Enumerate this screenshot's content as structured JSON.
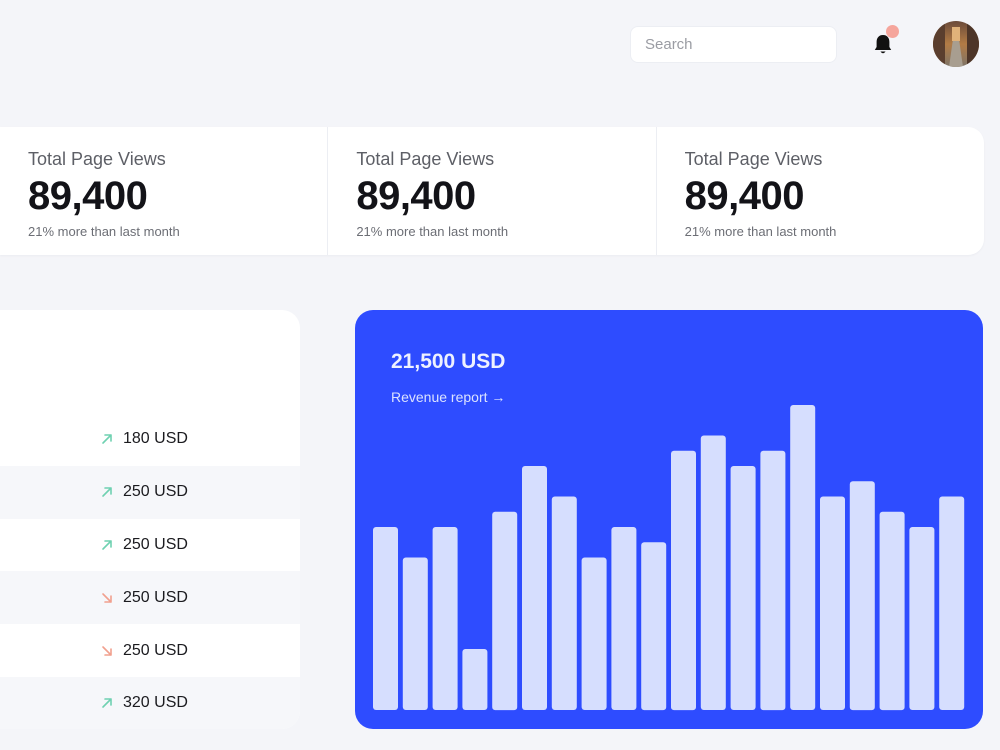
{
  "header": {
    "search_placeholder": "Search",
    "has_notification": true
  },
  "stats": [
    {
      "label": "Total Page Views",
      "value": "89,400",
      "note": "21% more than last month"
    },
    {
      "label": "Total Page Views",
      "value": "89,400",
      "note": "21% more than last month"
    },
    {
      "label": "Total Page Views",
      "value": "89,400",
      "note": "21% more than last month"
    }
  ],
  "transactions": [
    {
      "amount": "180 USD",
      "trend": "up"
    },
    {
      "amount": "250 USD",
      "trend": "up"
    },
    {
      "amount": "250 USD",
      "trend": "up"
    },
    {
      "amount": "250 USD",
      "trend": "down"
    },
    {
      "amount": "250 USD",
      "trend": "down"
    },
    {
      "amount": "320 USD",
      "trend": "up"
    }
  ],
  "revenue": {
    "amount": "21,500 USD",
    "link_label": "Revenue report →"
  },
  "chart_data": {
    "type": "bar",
    "values": [
      60,
      50,
      60,
      20,
      65,
      80,
      70,
      50,
      60,
      55,
      85,
      90,
      80,
      85,
      100,
      70,
      75,
      65,
      60,
      70
    ],
    "ylim": [
      0,
      100
    ]
  },
  "colors": {
    "accent": "#2e4cff",
    "bar": "#d6defe",
    "trend_up": "#6fd1b1",
    "trend_down": "#f1a08e",
    "notification_dot": "#f5a59c"
  },
  "icons": {
    "bell": "bell-icon",
    "up": "arrow-up-right-icon",
    "down": "arrow-down-right-icon"
  }
}
